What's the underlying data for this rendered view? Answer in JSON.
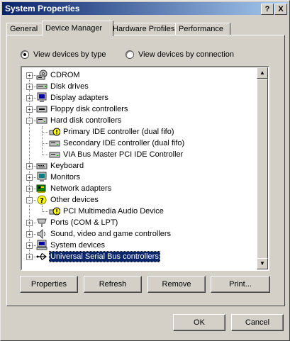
{
  "window": {
    "title": "System Properties",
    "help_glyph": "?",
    "close_glyph": "X"
  },
  "tabs": [
    {
      "label": "General"
    },
    {
      "label": "Device Manager"
    },
    {
      "label": "Hardware Profiles"
    },
    {
      "label": "Performance"
    }
  ],
  "view_options": {
    "by_type": "View devices by type",
    "by_connection": "View devices by connection",
    "selected": "by_type"
  },
  "devices": [
    {
      "label": "CDROM",
      "icon": "cdrom-icon",
      "expander": "+"
    },
    {
      "label": "Disk drives",
      "icon": "disk-drive-icon",
      "expander": "+"
    },
    {
      "label": "Display adapters",
      "icon": "display-adapter-icon",
      "expander": "+"
    },
    {
      "label": "Floppy disk controllers",
      "icon": "floppy-controller-icon",
      "expander": "+"
    },
    {
      "label": "Hard disk controllers",
      "icon": "hard-disk-controller-icon",
      "expander": "-",
      "children": [
        {
          "label": "Primary IDE controller (dual fifo)",
          "icon": "warning-icon"
        },
        {
          "label": "Secondary IDE controller (dual fifo)",
          "icon": "ide-controller-icon"
        },
        {
          "label": "VIA Bus Master PCI IDE Controller",
          "icon": "ide-controller-icon"
        }
      ]
    },
    {
      "label": "Keyboard",
      "icon": "keyboard-icon",
      "expander": "+"
    },
    {
      "label": "Monitors",
      "icon": "monitor-icon",
      "expander": "+"
    },
    {
      "label": "Network adapters",
      "icon": "network-adapter-icon",
      "expander": "+"
    },
    {
      "label": "Other devices",
      "icon": "question-icon",
      "expander": "-",
      "children": [
        {
          "label": "PCI Multimedia Audio Device",
          "icon": "warning-icon"
        }
      ]
    },
    {
      "label": "Ports (COM & LPT)",
      "icon": "port-icon",
      "expander": "+"
    },
    {
      "label": "Sound, video and game controllers",
      "icon": "sound-icon",
      "expander": "+"
    },
    {
      "label": "System devices",
      "icon": "system-device-icon",
      "expander": "+"
    },
    {
      "label": "Universal Serial Bus controllers",
      "icon": "usb-icon",
      "expander": "+",
      "selected": true
    }
  ],
  "scrollbar": {
    "up_glyph": "▲",
    "down_glyph": "▼"
  },
  "buttons": {
    "properties": "Properties",
    "refresh": "Refresh",
    "remove": "Remove",
    "print": "Print...",
    "ok": "OK",
    "cancel": "Cancel"
  },
  "colors": {
    "title_start": "#0a246a",
    "title_end": "#a6caf0",
    "face": "#d4d0c8",
    "selection": "#0a246a"
  }
}
